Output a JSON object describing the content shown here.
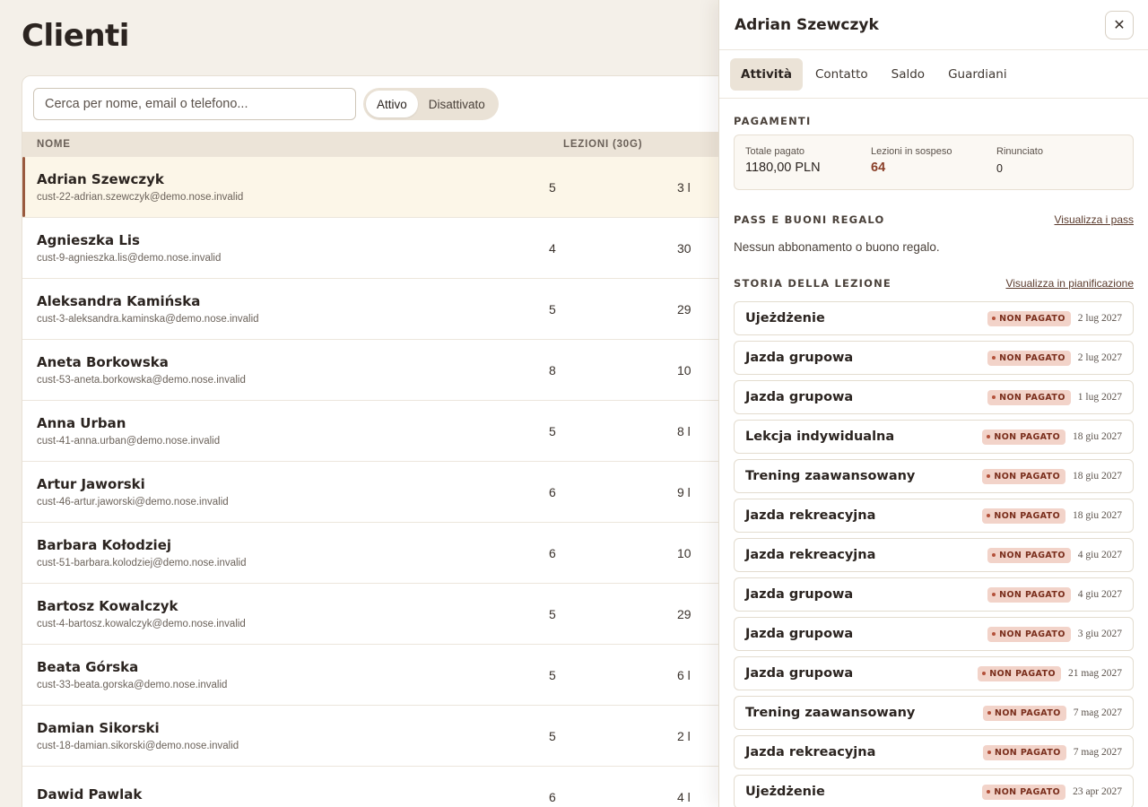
{
  "page": {
    "title": "Clienti"
  },
  "search": {
    "placeholder": "Cerca per nome, email o telefono..."
  },
  "status_filter": {
    "options": [
      "Attivo",
      "Disattivato"
    ],
    "selected": "Attivo"
  },
  "table": {
    "headers": {
      "name": "NOME",
      "lessons": "LEZIONI (30G)"
    },
    "rows": [
      {
        "name": "Adrian Szewczyk",
        "email": "cust-22-adrian.szewczyk@demo.nose.invalid",
        "lessons": "5",
        "last": "3 l"
      },
      {
        "name": "Agnieszka Lis",
        "email": "cust-9-agnieszka.lis@demo.nose.invalid",
        "lessons": "4",
        "last": "30"
      },
      {
        "name": "Aleksandra Kamińska",
        "email": "cust-3-aleksandra.kaminska@demo.nose.invalid",
        "lessons": "5",
        "last": "29"
      },
      {
        "name": "Aneta Borkowska",
        "email": "cust-53-aneta.borkowska@demo.nose.invalid",
        "lessons": "8",
        "last": "10"
      },
      {
        "name": "Anna Urban",
        "email": "cust-41-anna.urban@demo.nose.invalid",
        "lessons": "5",
        "last": "8 l"
      },
      {
        "name": "Artur Jaworski",
        "email": "cust-46-artur.jaworski@demo.nose.invalid",
        "lessons": "6",
        "last": "9 l"
      },
      {
        "name": "Barbara Kołodziej",
        "email": "cust-51-barbara.kolodziej@demo.nose.invalid",
        "lessons": "6",
        "last": "10"
      },
      {
        "name": "Bartosz Kowalczyk",
        "email": "cust-4-bartosz.kowalczyk@demo.nose.invalid",
        "lessons": "5",
        "last": "29"
      },
      {
        "name": "Beata Górska",
        "email": "cust-33-beata.gorska@demo.nose.invalid",
        "lessons": "5",
        "last": "6 l"
      },
      {
        "name": "Damian Sikorski",
        "email": "cust-18-damian.sikorski@demo.nose.invalid",
        "lessons": "5",
        "last": "2 l"
      },
      {
        "name": "Dawid Pawlak",
        "email": "",
        "lessons": "6",
        "last": "4 l"
      }
    ]
  },
  "drawer": {
    "title": "Adrian Szewczyk",
    "close_icon": "close-icon",
    "tabs": [
      "Attività",
      "Contatto",
      "Saldo",
      "Guardiani"
    ],
    "active_tab": "Attività",
    "payments": {
      "title": "PAGAMENTI",
      "total_label": "Totale pagato",
      "total_value": "1180,00 PLN",
      "pending_label": "Lezioni in sospeso",
      "pending_value": "64",
      "waived_label": "Rinunciato",
      "waived_value": "0"
    },
    "passes": {
      "title": "PASS E BUONI REGALO",
      "link": "Visualizza i pass",
      "empty": "Nessun abbonamento o buono regalo."
    },
    "history": {
      "title": "STORIA DELLA LEZIONE",
      "link": "Visualizza in pianificazione",
      "items": [
        {
          "name": "Ujeżdżenie",
          "status": "NON PAGATO",
          "date": "2 lug 2027"
        },
        {
          "name": "Jazda grupowa",
          "status": "NON PAGATO",
          "date": "2 lug 2027"
        },
        {
          "name": "Jazda grupowa",
          "status": "NON PAGATO",
          "date": "1 lug 2027"
        },
        {
          "name": "Lekcja indywidualna",
          "status": "NON PAGATO",
          "date": "18 giu 2027"
        },
        {
          "name": "Trening zaawansowany",
          "status": "NON PAGATO",
          "date": "18 giu 2027"
        },
        {
          "name": "Jazda rekreacyjna",
          "status": "NON PAGATO",
          "date": "18 giu 2027"
        },
        {
          "name": "Jazda rekreacyjna",
          "status": "NON PAGATO",
          "date": "4 giu 2027"
        },
        {
          "name": "Jazda grupowa",
          "status": "NON PAGATO",
          "date": "4 giu 2027"
        },
        {
          "name": "Jazda grupowa",
          "status": "NON PAGATO",
          "date": "3 giu 2027"
        },
        {
          "name": "Jazda grupowa",
          "status": "NON PAGATO",
          "date": "21 mag 2027"
        },
        {
          "name": "Trening zaawansowany",
          "status": "NON PAGATO",
          "date": "7 mag 2027"
        },
        {
          "name": "Jazda rekreacyjna",
          "status": "NON PAGATO",
          "date": "7 mag 2027"
        },
        {
          "name": "Ujeżdżenie",
          "status": "NON PAGATO",
          "date": "23 apr 2027"
        }
      ]
    }
  },
  "colors": {
    "accent": "#9a5a3f",
    "badge_bg": "#f2d3c9",
    "badge_text": "#7a2e1c",
    "selected_row": "#fcf6e8"
  }
}
